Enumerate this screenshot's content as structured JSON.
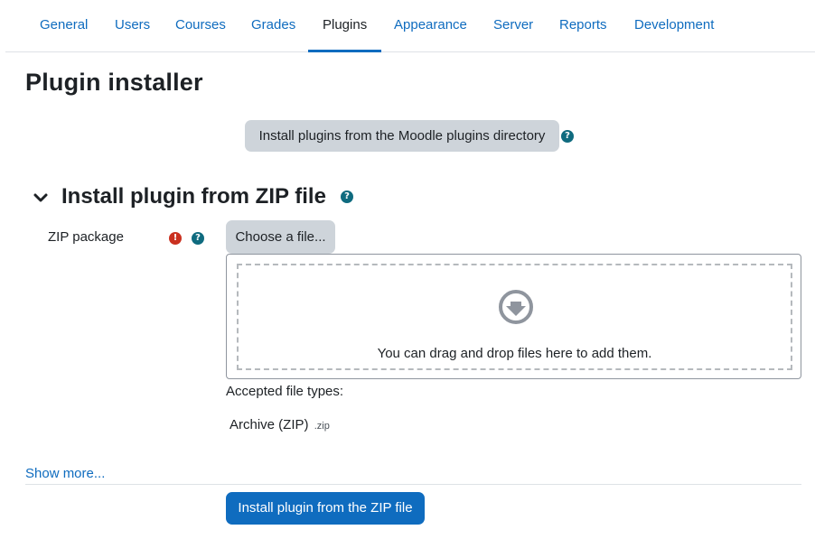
{
  "tabs": [
    {
      "label": "General",
      "active": false
    },
    {
      "label": "Users",
      "active": false
    },
    {
      "label": "Courses",
      "active": false
    },
    {
      "label": "Grades",
      "active": false
    },
    {
      "label": "Plugins",
      "active": true
    },
    {
      "label": "Appearance",
      "active": false
    },
    {
      "label": "Server",
      "active": false
    },
    {
      "label": "Reports",
      "active": false
    },
    {
      "label": "Development",
      "active": false
    }
  ],
  "page": {
    "title": "Plugin installer",
    "directory_button": "Install plugins from the Moodle plugins directory"
  },
  "section": {
    "title": "Install plugin from ZIP file",
    "expanded": true
  },
  "zip_field": {
    "label": "ZIP package",
    "required_icon": "exclamation-circle-icon",
    "help_icon": "question-circle-icon",
    "choose_button": "Choose a file...",
    "drop_text": "You can drag and drop files here to add them.",
    "drop_icon": "arrow-circle-down-icon",
    "accepted_label": "Accepted file types:",
    "accepted_type_name": "Archive (ZIP)",
    "accepted_type_ext": ".zip"
  },
  "footer": {
    "show_more": "Show more...",
    "submit_button": "Install plugin from the ZIP file"
  },
  "colors": {
    "link": "#0f6cbf",
    "primary": "#0f6cbf",
    "secondary_button": "#ced4da",
    "help_icon": "#0f6b7f",
    "required_icon": "#ca3120",
    "text": "#1d2125"
  }
}
